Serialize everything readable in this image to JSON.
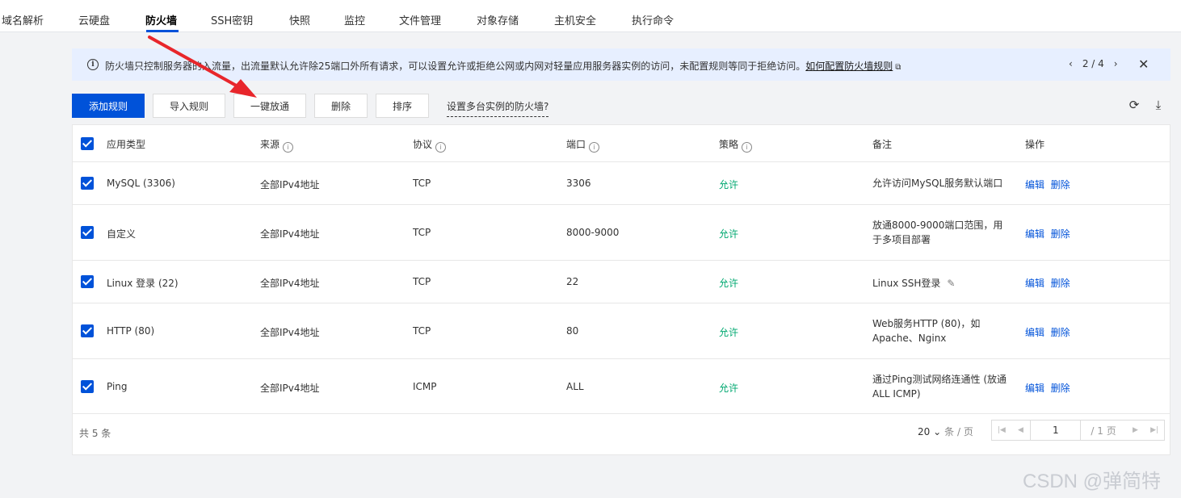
{
  "tabs": [
    {
      "label": "域名解析",
      "active": false
    },
    {
      "label": "云硬盘",
      "active": false
    },
    {
      "label": "防火墙",
      "active": true
    },
    {
      "label": "SSH密钥",
      "active": false
    },
    {
      "label": "快照",
      "active": false
    },
    {
      "label": "监控",
      "active": false
    },
    {
      "label": "文件管理",
      "active": false
    },
    {
      "label": "对象存储",
      "active": false
    },
    {
      "label": "主机安全",
      "active": false
    },
    {
      "label": "执行命令",
      "active": false
    }
  ],
  "banner": {
    "text": "防火墙只控制服务器的入流量，出流量默认允许除25端口外所有请求，可以设置允许或拒绝公网或内网对轻量应用服务器实例的访问，未配置规则等同于拒绝访问。",
    "link": "如何配置防火墙规则",
    "pager": "2 / 4"
  },
  "toolbar": {
    "add": "添加规则",
    "import": "导入规则",
    "one_click": "一键放通",
    "delete": "删除",
    "sort": "排序",
    "multi_instance": "设置多台实例的防火墙?"
  },
  "table": {
    "headers": [
      "应用类型",
      "来源",
      "协议",
      "端口",
      "策略",
      "备注",
      "操作"
    ],
    "rows": [
      {
        "app": "MySQL (3306)",
        "source": "全部IPv4地址",
        "protocol": "TCP",
        "port": "3306",
        "policy": "允许",
        "note": "允许访问MySQL服务默认端口"
      },
      {
        "app": "自定义",
        "source": "全部IPv4地址",
        "protocol": "TCP",
        "port": "8000-9000",
        "policy": "允许",
        "note": "放通8000-9000端口范围，用于多项目部署"
      },
      {
        "app": "Linux 登录 (22)",
        "source": "全部IPv4地址",
        "protocol": "TCP",
        "port": "22",
        "policy": "允许",
        "note": "Linux SSH登录"
      },
      {
        "app": "HTTP (80)",
        "source": "全部IPv4地址",
        "protocol": "TCP",
        "port": "80",
        "policy": "允许",
        "note": "Web服务HTTP (80)，如Apache、Nginx"
      },
      {
        "app": "Ping",
        "source": "全部IPv4地址",
        "protocol": "ICMP",
        "port": "ALL",
        "policy": "允许",
        "note": "通过Ping测试网络连通性 (放通ALL ICMP)"
      }
    ],
    "actions": {
      "edit": "编辑",
      "delete": "删除"
    }
  },
  "footer": {
    "total": "共 5 条",
    "page_size": "20",
    "page_size_unit": "条 / 页",
    "current_page": "1",
    "page_count": "/ 1 页"
  },
  "watermark": "CSDN @弹简特",
  "colors": {
    "primary": "#0052d9",
    "allow": "#00a870",
    "banner_bg": "#e7efff",
    "arrow": "#e8262b"
  }
}
